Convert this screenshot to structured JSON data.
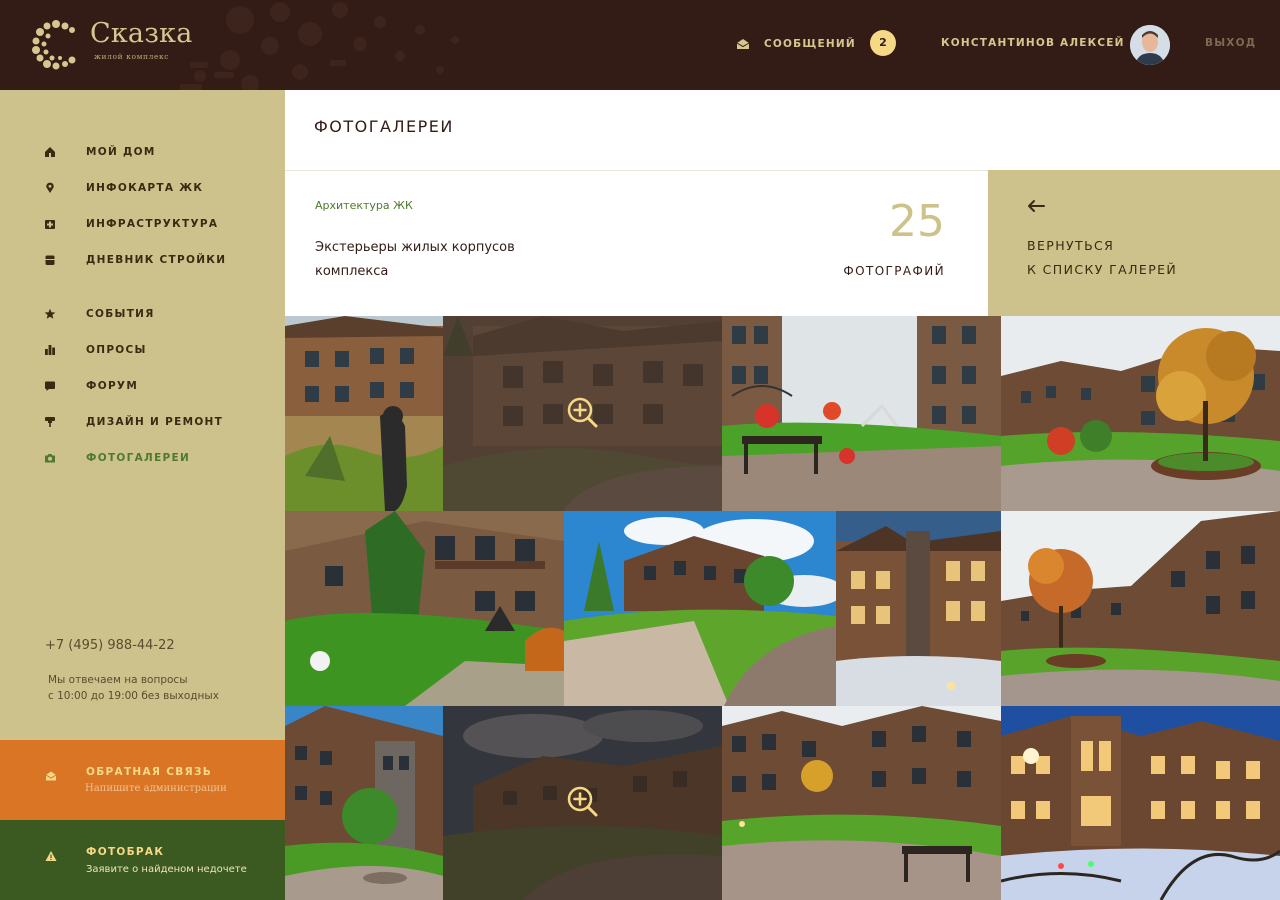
{
  "header": {
    "logo": {
      "title": "Сказка",
      "subtitle": "жилой комплекс"
    },
    "messages_label": "СООБЩЕНИЙ",
    "messages_count": "2",
    "user_name": "КОНСТАНТИНОВ АЛЕКСЕЙ",
    "logout_label": "ВЫХОД"
  },
  "sidebar": {
    "group1": [
      {
        "label": "МОЙ ДОМ",
        "icon": "home-icon"
      },
      {
        "label": "ИНФОКАРТА ЖК",
        "icon": "map-pin-icon"
      },
      {
        "label": "ИНФРАСТРУКТУРА",
        "icon": "infrastructure-icon"
      },
      {
        "label": "ДНЕВНИК СТРОЙКИ",
        "icon": "diary-icon"
      }
    ],
    "group2": [
      {
        "label": "СОБЫТИЯ",
        "icon": "star-icon"
      },
      {
        "label": "ОПРОСЫ",
        "icon": "poll-icon"
      },
      {
        "label": "ФОРУМ",
        "icon": "chat-icon"
      },
      {
        "label": "ДИЗАЙН И РЕМОНТ",
        "icon": "paint-roller-icon"
      },
      {
        "label": "ФОТОГАЛЕРЕИ",
        "icon": "camera-icon",
        "active": true
      }
    ],
    "phone": "+7 (495) 988-44-22",
    "hours_line1": "Мы отвечаем на вопросы",
    "hours_line2": "с 10:00 до 19:00 без выходных",
    "feedback": {
      "title": "ОБРАТНАЯ СВЯЗЬ",
      "subtitle": "Напишите администрации"
    },
    "defect": {
      "title": "ФОТОБРАК",
      "subtitle": "Заявите о найденом недочете"
    }
  },
  "main": {
    "page_title": "ФОТОГАЛЕРЕИ",
    "category": "Архитектура ЖК",
    "gallery_title": "Экстерьеры жилых корпусов комплекса",
    "photo_count": "25",
    "photo_count_label": "ФОТОГРАФИЙ",
    "back_line1": "ВЕРНУТЬСЯ",
    "back_line2": "К СПИСКУ ГАЛЕРЕЙ"
  },
  "colors": {
    "header_bg": "#331c16",
    "sidebar_bg": "#cdc28b",
    "accent_green": "#4e7a2d",
    "feedback_bg": "#d97525",
    "defect_bg": "#3b5a22",
    "badge_bg": "#f6d986"
  }
}
